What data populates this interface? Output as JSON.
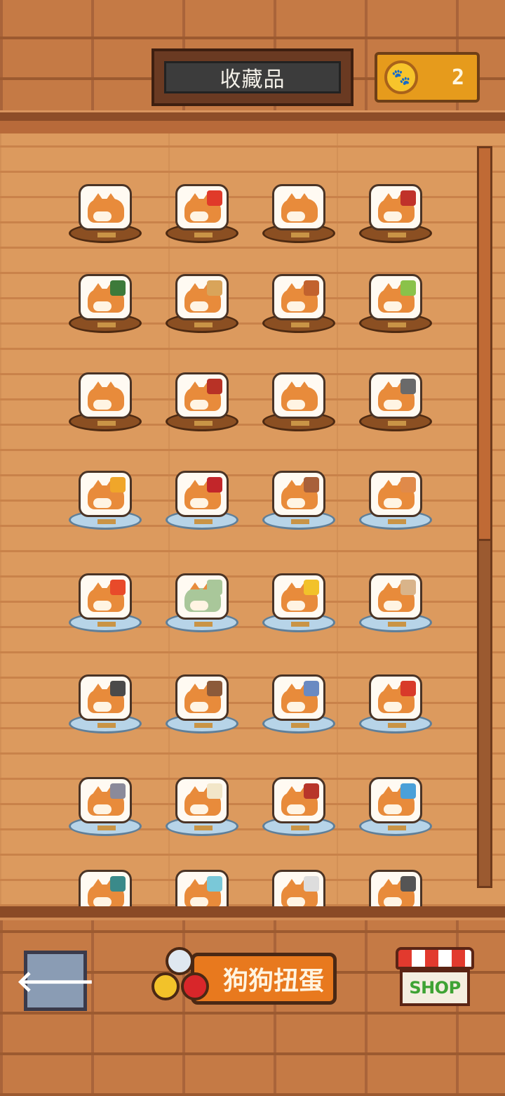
{
  "header": {
    "title": "收藏品",
    "coin_icon": "paw-coin-icon",
    "coin_count": "2"
  },
  "collection": {
    "items": [
      {
        "name": "shiba-standing",
        "pedestal": "wood",
        "prop_color": ""
      },
      {
        "name": "framed-portrait",
        "pedestal": "wood",
        "prop_color": "#e03a2a"
      },
      {
        "name": "shiba-sitting",
        "pedestal": "wood",
        "prop_color": ""
      },
      {
        "name": "shiba-with-bowl",
        "pedestal": "wood",
        "prop_color": "#c0322a"
      },
      {
        "name": "shiba-with-cactus",
        "pedestal": "wood",
        "prop_color": "#3d7a3a"
      },
      {
        "name": "lamp-stand",
        "pedestal": "wood",
        "prop_color": "#d9a45a"
      },
      {
        "name": "wardrobe",
        "pedestal": "wood",
        "prop_color": "#c2622e"
      },
      {
        "name": "shiba-under-table",
        "pedestal": "wood",
        "prop_color": "#8ac24a"
      },
      {
        "name": "shiba-sleeping",
        "pedestal": "wood",
        "prop_color": ""
      },
      {
        "name": "shiba-with-hat",
        "pedestal": "wood",
        "prop_color": "#b83226"
      },
      {
        "name": "shiba-happy",
        "pedestal": "wood",
        "prop_color": ""
      },
      {
        "name": "shiba-with-laptop",
        "pedestal": "wood",
        "prop_color": "#6a6a6a"
      },
      {
        "name": "shiba-on-armchair",
        "pedestal": "glass",
        "prop_color": "#f0a62a"
      },
      {
        "name": "shiba-on-red-sofa",
        "pedestal": "glass",
        "prop_color": "#c2262a"
      },
      {
        "name": "round-window",
        "pedestal": "glass",
        "prop_color": "#a8603a"
      },
      {
        "name": "shiba-on-couch",
        "pedestal": "glass",
        "prop_color": "#e08a4a"
      },
      {
        "name": "tv-console",
        "pedestal": "glass",
        "prop_color": "#e84a2a"
      },
      {
        "name": "green-cat",
        "pedestal": "glass",
        "prop_color": "#a9c79a"
      },
      {
        "name": "computer-monitor",
        "pedestal": "glass",
        "prop_color": "#f2c22a"
      },
      {
        "name": "mirror-cat",
        "pedestal": "glass",
        "prop_color": "#d9b48a"
      },
      {
        "name": "shiba-with-speaker",
        "pedestal": "glass",
        "prop_color": "#4a4a4a"
      },
      {
        "name": "tv-cabinet",
        "pedestal": "glass",
        "prop_color": "#8c5a3a"
      },
      {
        "name": "shiba-with-aquarium",
        "pedestal": "glass",
        "prop_color": "#6a8ac2"
      },
      {
        "name": "shiba-on-cushion",
        "pedestal": "glass",
        "prop_color": "#d83a2a"
      },
      {
        "name": "boy-with-shiba",
        "pedestal": "glass",
        "prop_color": "#8a8a9a"
      },
      {
        "name": "cake-table",
        "pedestal": "glass",
        "prop_color": "#f2e6c8"
      },
      {
        "name": "shiba-with-tower",
        "pedestal": "glass",
        "prop_color": "#b8362a"
      },
      {
        "name": "shiba-with-capsules",
        "pedestal": "glass",
        "prop_color": "#4aa0d8"
      },
      {
        "name": "shiba-in-bathtub",
        "pedestal": "glass",
        "prop_color": "#3a8a8a"
      },
      {
        "name": "shiba-with-bubble",
        "pedestal": "glass",
        "prop_color": "#7ac8d8"
      },
      {
        "name": "shiba-at-desk",
        "pedestal": "glass",
        "prop_color": "#dddddd"
      },
      {
        "name": "arched-door",
        "pedestal": "glass",
        "prop_color": "#555555"
      }
    ]
  },
  "footer": {
    "back_icon": "back-arrow-icon",
    "back_symbol": "🡐",
    "gacha_label": "狗狗扭蛋",
    "shop_label": "SHOP"
  }
}
